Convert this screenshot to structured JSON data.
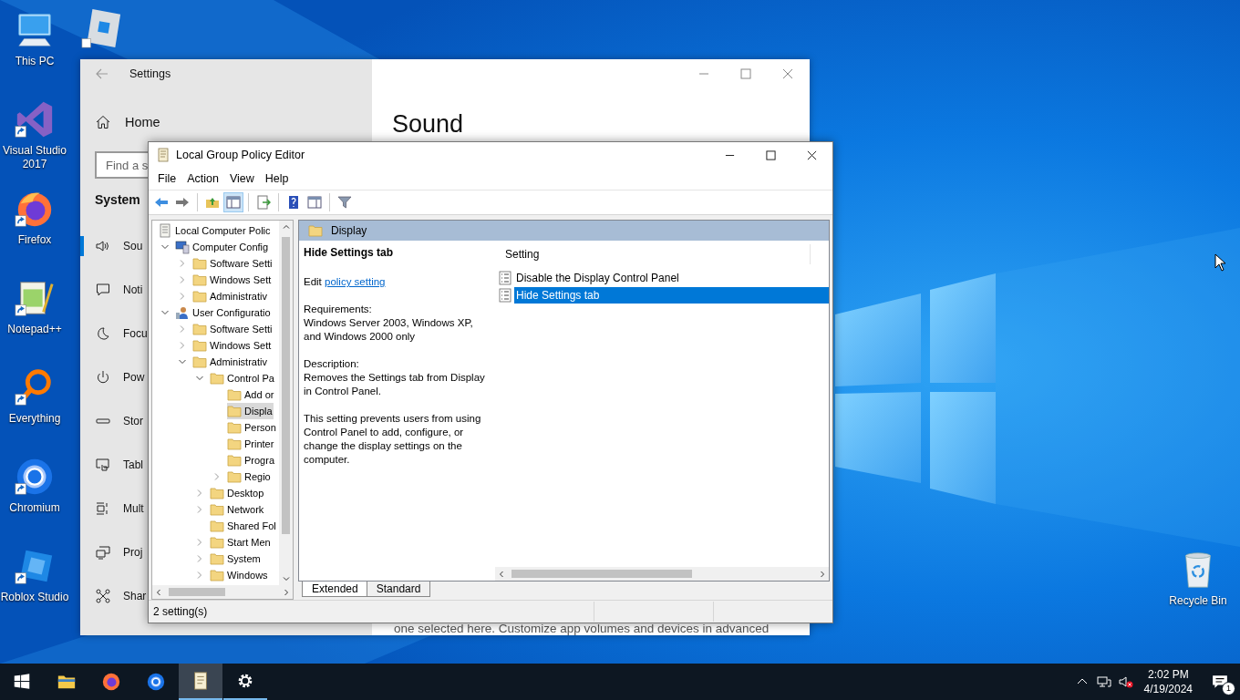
{
  "desktop": {
    "icons": [
      {
        "kind": "computer",
        "label": "This PC",
        "shortcut": false
      },
      {
        "kind": "visual-studio",
        "label": "Visual Studio 2017",
        "shortcut": true
      },
      {
        "kind": "firefox",
        "label": "Firefox",
        "shortcut": true
      },
      {
        "kind": "notepad",
        "label": "Notepad++",
        "shortcut": true
      },
      {
        "kind": "everything",
        "label": "Everything",
        "shortcut": true
      },
      {
        "kind": "chromium",
        "label": "Chromium",
        "shortcut": true
      },
      {
        "kind": "roblox",
        "label": "Roblox Studio",
        "shortcut": true
      }
    ],
    "recycle_bin": {
      "label": "Recycle Bin"
    }
  },
  "settings": {
    "title": "Settings",
    "home": "Home",
    "search_placeholder": "Find a s",
    "section": "System",
    "nav": [
      {
        "kind": "sound",
        "label": "Sou",
        "selected": true
      },
      {
        "kind": "notifications",
        "label": "Noti",
        "selected": false
      },
      {
        "kind": "focus",
        "label": "Focu",
        "selected": false
      },
      {
        "kind": "power",
        "label": "Pow",
        "selected": false
      },
      {
        "kind": "storage",
        "label": "Stor",
        "selected": false
      },
      {
        "kind": "tablet",
        "label": "Tabl",
        "selected": false
      },
      {
        "kind": "multitasking",
        "label": "Mult",
        "selected": false
      },
      {
        "kind": "projecting",
        "label": "Proj",
        "selected": false
      },
      {
        "kind": "shared",
        "label": "Shar",
        "selected": false
      }
    ],
    "heading": "Sound",
    "footer_text": "one selected here. Customize app volumes and devices in advanced"
  },
  "gpe": {
    "title": "Local Group Policy Editor",
    "menu": [
      "File",
      "Action",
      "View",
      "Help"
    ],
    "toolbar": [
      {
        "kind": "back",
        "on": false
      },
      {
        "kind": "forward",
        "on": false
      },
      {
        "kind": "separator"
      },
      {
        "kind": "up",
        "on": false
      },
      {
        "kind": "tree",
        "on": true
      },
      {
        "kind": "separator"
      },
      {
        "kind": "export",
        "on": false
      },
      {
        "kind": "separator"
      },
      {
        "kind": "help",
        "on": false
      },
      {
        "kind": "pane",
        "on": false
      },
      {
        "kind": "separator"
      },
      {
        "kind": "filter",
        "on": false
      }
    ],
    "tree": [
      {
        "kind": "policy",
        "label": "Local Computer Polic",
        "selected": false,
        "children": [
          {
            "kind": "computer",
            "label": "Computer Config",
            "expanded": true,
            "selected": false,
            "children": [
              {
                "kind": "folder",
                "label": "Software Setti",
                "expanded": false,
                "selected": false
              },
              {
                "kind": "folder",
                "label": "Windows Sett",
                "expanded": false,
                "selected": false
              },
              {
                "kind": "folder",
                "label": "Administrativ",
                "expanded": false,
                "selected": false
              }
            ]
          },
          {
            "kind": "user",
            "label": "User Configuratio",
            "expanded": true,
            "selected": false,
            "children": [
              {
                "kind": "folder",
                "label": "Software Setti",
                "expanded": false,
                "selected": false
              },
              {
                "kind": "folder",
                "label": "Windows Sett",
                "expanded": false,
                "selected": false
              },
              {
                "kind": "folder",
                "label": "Administrativ",
                "expanded": true,
                "selected": false,
                "children": [
                  {
                    "kind": "folder",
                    "label": "Control Pa",
                    "expanded": true,
                    "selected": false,
                    "children": [
                      {
                        "kind": "folder",
                        "label": "Add or",
                        "selected": false
                      },
                      {
                        "kind": "folder",
                        "label": "Displa",
                        "selected": true
                      },
                      {
                        "kind": "folder",
                        "label": "Person",
                        "selected": false
                      },
                      {
                        "kind": "folder",
                        "label": "Printer",
                        "selected": false
                      },
                      {
                        "kind": "folder",
                        "label": "Progra",
                        "selected": false
                      },
                      {
                        "kind": "folder",
                        "label": "Regio",
                        "expanded": false,
                        "selected": false
                      }
                    ]
                  },
                  {
                    "kind": "folder",
                    "label": "Desktop",
                    "expanded": false,
                    "selected": false
                  },
                  {
                    "kind": "folder",
                    "label": "Network",
                    "expanded": false,
                    "selected": false
                  },
                  {
                    "kind": "folder",
                    "label": "Shared Fol",
                    "selected": false
                  },
                  {
                    "kind": "folder",
                    "label": "Start Men",
                    "expanded": false,
                    "selected": false
                  },
                  {
                    "kind": "folder",
                    "label": "System",
                    "expanded": false,
                    "selected": false
                  },
                  {
                    "kind": "folder",
                    "label": "Windows",
                    "expanded": false,
                    "selected": false
                  }
                ]
              }
            ]
          }
        ]
      }
    ],
    "path_header": "Display",
    "detail": {
      "title": "Hide Settings tab",
      "edit_prefix": "Edit",
      "link": "policy setting",
      "paragraphs": [
        "Requirements:\nWindows Server 2003, Windows XP, and Windows 2000 only",
        "Description:\nRemoves the Settings tab from Display in Control Panel.",
        "This setting prevents users from using Control Panel to add, configure, or change the display settings on the computer."
      ]
    },
    "list": {
      "column": "Setting",
      "rows": [
        {
          "label": "Disable the Display Control Panel",
          "selected": false
        },
        {
          "label": "Hide Settings tab",
          "selected": true
        }
      ]
    },
    "tabs": [
      {
        "label": "Extended",
        "selected": true
      },
      {
        "label": "Standard",
        "selected": false
      }
    ],
    "status": "2 setting(s)"
  },
  "taskbar": {
    "apps": [
      {
        "kind": "start",
        "open": false,
        "active": false
      },
      {
        "kind": "explorer",
        "open": false,
        "active": false
      },
      {
        "kind": "firefox",
        "open": false,
        "active": false
      },
      {
        "kind": "chromium",
        "open": false,
        "active": false
      },
      {
        "kind": "policy",
        "open": true,
        "active": true
      },
      {
        "kind": "settings",
        "open": true,
        "active": false
      }
    ],
    "time": "2:02 PM",
    "date": "4/19/2024",
    "notification_count": "1"
  }
}
